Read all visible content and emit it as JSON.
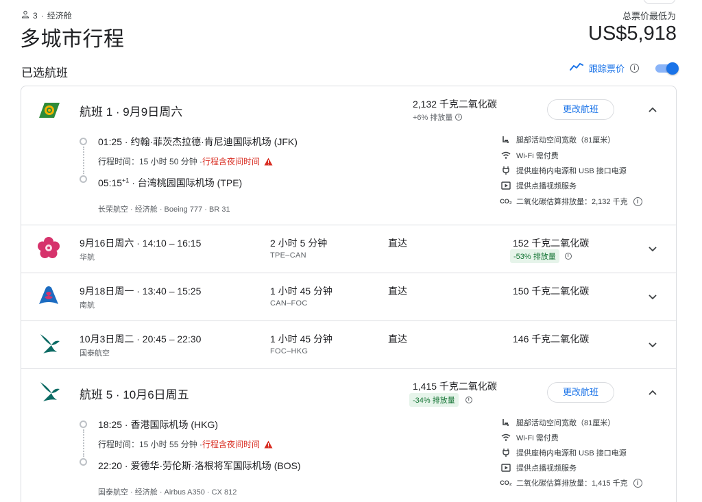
{
  "header": {
    "passengers": "3",
    "cabin": "经济舱",
    "title": "多城市行程",
    "price_label": "总票价最低为",
    "price": "US$5,918"
  },
  "selected": {
    "title": "已选航班",
    "track_label": "跟踪票价",
    "track_enabled": true
  },
  "leg1": {
    "title": "航班 1 · 9月9日周六",
    "emissions": "2,132 千克二氧化碳",
    "emissions_delta": "+6% 排放量",
    "change_label": "更改航班",
    "depart": "01:25 · 约翰·菲茨杰拉德·肯尼迪国际机场 (JFK)",
    "duration_text": "行程时间：15 小时 50 分钟 · ",
    "overnight": "行程含夜间时间",
    "arrive_time": "05:15",
    "arrive_sup": "+1",
    "arrive_rest": " · 台湾桃园国际机场 (TPE)",
    "airline_info": "长荣航空 · 经济舱 · Boeing 777 · BR 31",
    "amenities": [
      "腿部活动空间宽敞（81厘米）",
      "Wi-Fi 需付费",
      "提供座椅内电源和 USB 接口电源",
      "提供点播视频服务",
      "二氧化碳估算排放量：2,132 千克"
    ]
  },
  "legs_collapsed": [
    {
      "date_time": "9月16日周六 · 14:10 – 16:15",
      "airline": "华航",
      "duration": "2 小时 5 分钟",
      "route": "TPE–CAN",
      "stops": "直达",
      "emissions": "152 千克二氧化碳",
      "emissions_badge": "-53% 排放量"
    },
    {
      "date_time": "9月18日周一 · 13:40 – 15:25",
      "airline": "南航",
      "duration": "1 小时 45 分钟",
      "route": "CAN–FOC",
      "stops": "直达",
      "emissions": "150 千克二氧化碳"
    },
    {
      "date_time": "10月3日周二 · 20:45 – 22:30",
      "airline": "国泰航空",
      "duration": "1 小时 45 分钟",
      "route": "FOC–HKG",
      "stops": "直达",
      "emissions": "146 千克二氧化碳"
    }
  ],
  "leg5": {
    "title": "航班 5 · 10月6日周五",
    "emissions": "1,415 千克二氧化碳",
    "emissions_delta": "-34% 排放量",
    "change_label": "更改航班",
    "depart": "18:25 · 香港国际机场 (HKG)",
    "duration_text": "行程时间：15 小时 55 分钟 · ",
    "overnight": "行程含夜间时间",
    "arrive": "22:20 · 爱德华·劳伦斯·洛根将军国际机场 (BOS)",
    "airline_info": "国泰航空 · 经济舱 · Airbus A350 · CX 812",
    "amenities": [
      "腿部活动空间宽敞（81厘米）",
      "Wi-Fi 需付费",
      "提供座椅内电源和 USB 接口电源",
      "提供点播视频服务",
      "二氧化碳估算排放量：1,415 千克"
    ]
  },
  "icons": {
    "co2_glyph": "CO₂",
    "info_glyph": "i"
  },
  "colors": {
    "accent": "#1a73e8",
    "warning": "#d93025",
    "good": "#137333",
    "eva_green": "#2e8b3a",
    "china_airlines_pink": "#d6336c",
    "china_southern_blue": "#1c6cc1",
    "cathay_green": "#0b6a63"
  }
}
